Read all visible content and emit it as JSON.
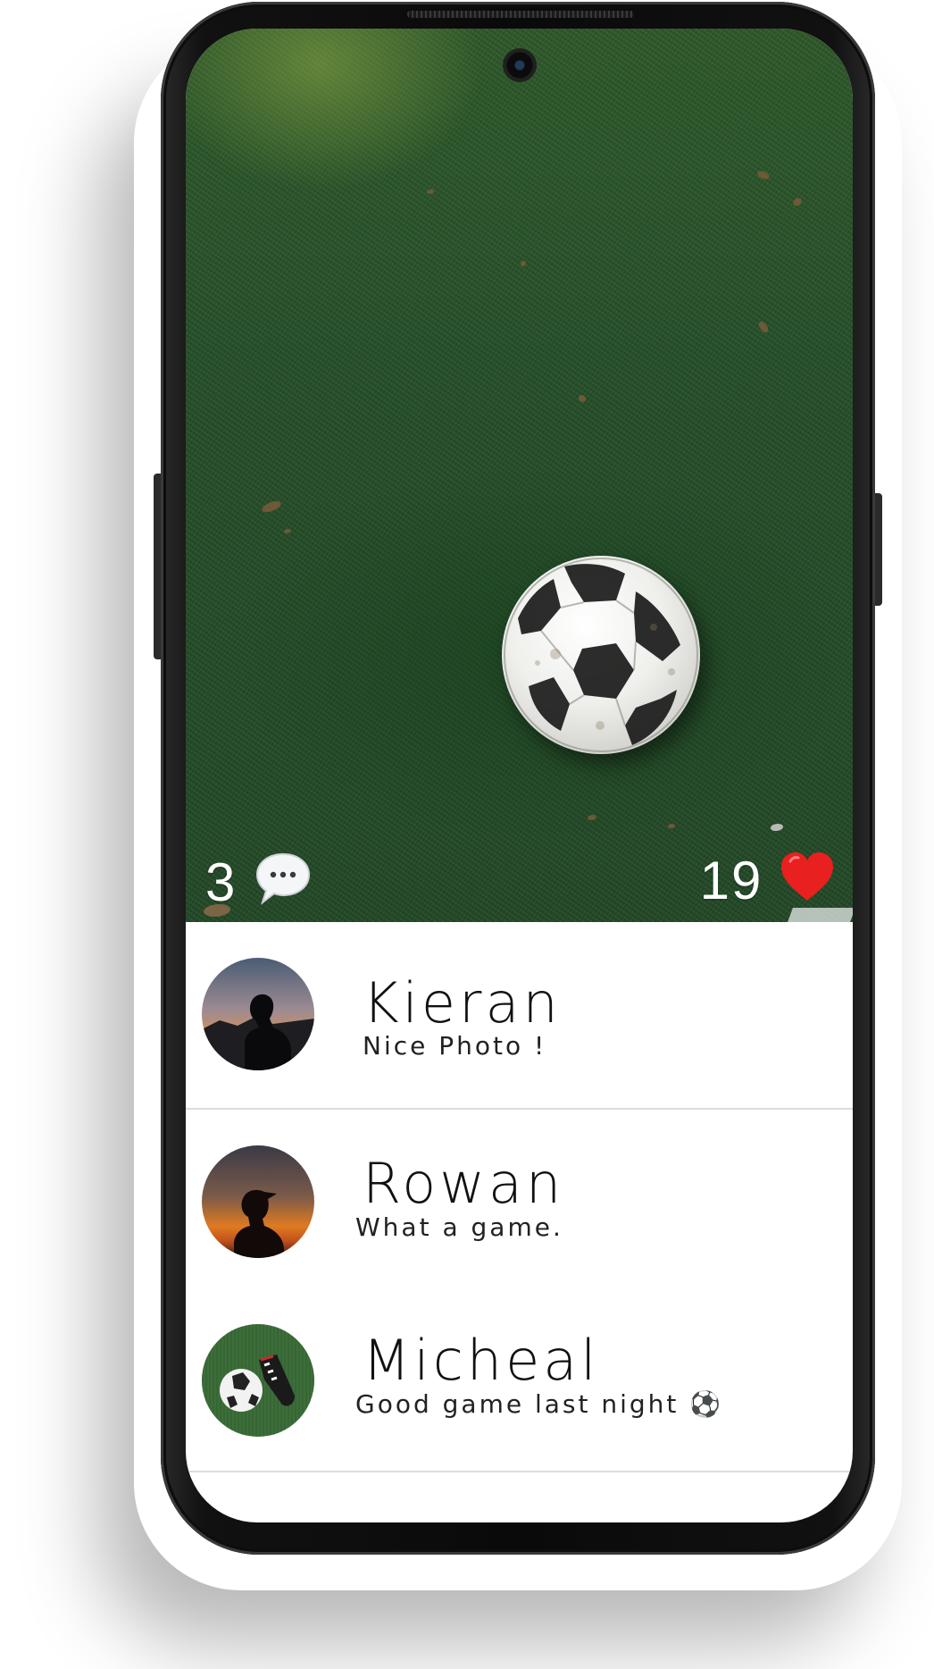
{
  "post": {
    "comment_count": "3",
    "like_count": "19",
    "comment_icon": "speech-bubble-icon",
    "like_icon": "red-heart-icon",
    "like_color": "#e8201f"
  },
  "comments": [
    {
      "name": "Kieran",
      "message": "Nice Photo !"
    },
    {
      "name": "Rowan",
      "message": "What a game."
    },
    {
      "name": "Micheal",
      "message": "Good game last night ⚽"
    }
  ]
}
